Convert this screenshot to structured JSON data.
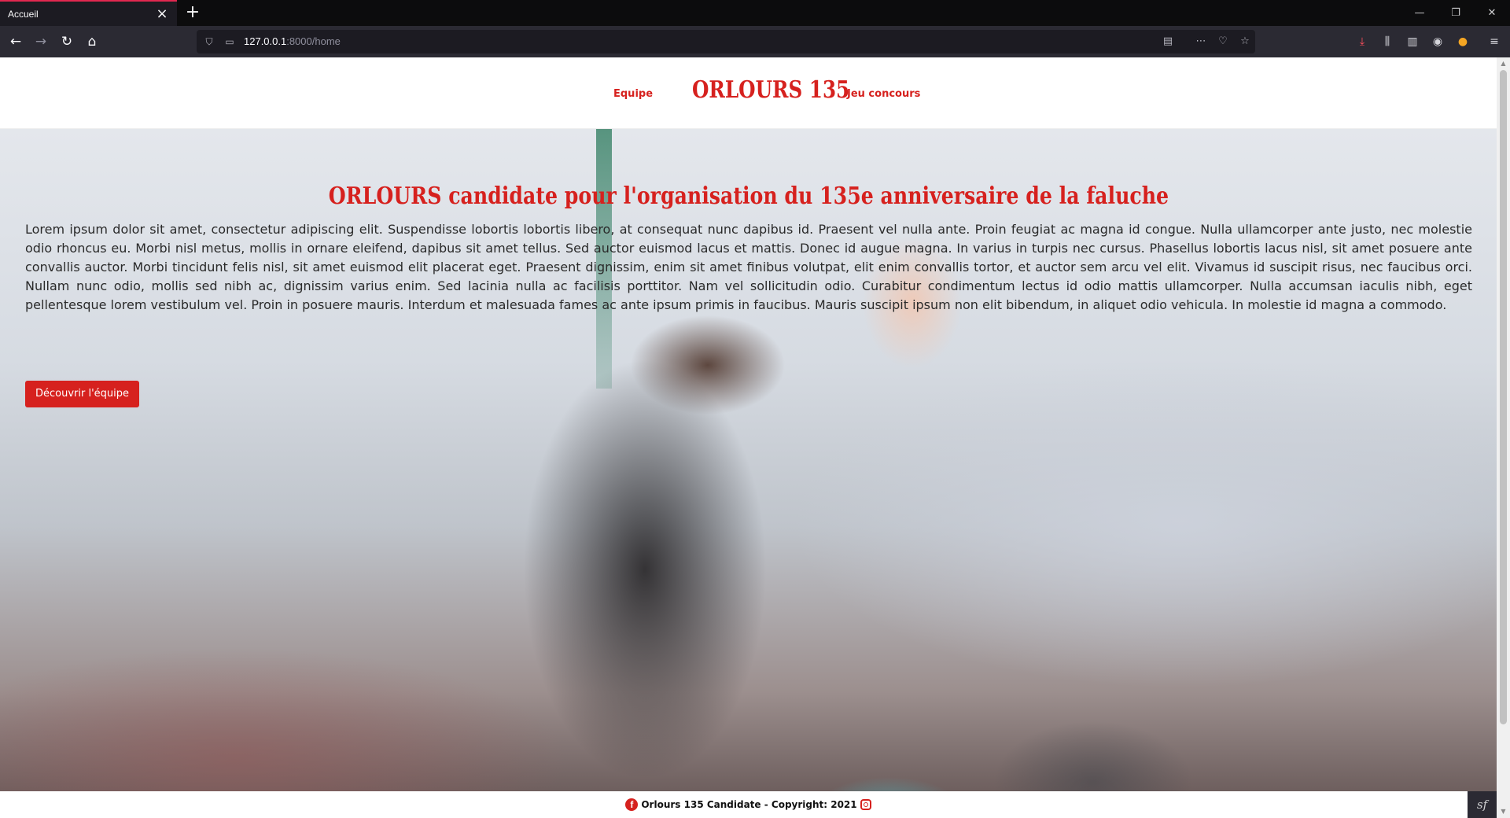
{
  "browser": {
    "tab": {
      "title": "Accueil",
      "close_icon": "×"
    },
    "new_tab_icon": "+",
    "window_controls": {
      "minimize": "—",
      "restore": "❐",
      "close": "✕"
    },
    "nav": {
      "back": "←",
      "forward": "→",
      "reload": "↻",
      "home": "⌂"
    },
    "url": {
      "host": "127.0.0.1",
      "rest": ":8000/home"
    },
    "url_icons": {
      "shield": "⛉",
      "page": "▭",
      "reader": "▤",
      "more": "⋯",
      "pocket": "♡",
      "bookmark": "☆"
    },
    "toolbar_icons": {
      "download": "⤓",
      "library": "⫼",
      "sidebar": "▥",
      "account": "◉",
      "extension": "●",
      "menu": "≡"
    }
  },
  "site": {
    "header": {
      "nav_left": "Equipe",
      "brand": "ORLOURS 135",
      "nav_right": "Jeu concours"
    },
    "hero": {
      "title": "ORLOURS candidate pour l'organisation du 135e anniversaire de la faluche",
      "text": "Lorem ipsum dolor sit amet, consectetur adipiscing elit. Suspendisse lobortis lobortis libero, at consequat nunc dapibus id. Praesent vel nulla ante. Proin feugiat ac magna id congue. Nulla ullamcorper ante justo, nec molestie odio rhoncus eu. Morbi nisl metus, mollis in ornare eleifend, dapibus sit amet tellus. Sed auctor euismod lacus et mattis. Donec id augue magna. In varius in turpis nec cursus. Phasellus lobortis lacus nisl, sit amet posuere ante convallis auctor. Morbi tincidunt felis nisl, sit amet euismod elit placerat eget. Praesent dignissim, enim sit amet finibus volutpat, elit enim convallis tortor, et auctor sem arcu vel elit. Vivamus id suscipit risus, nec faucibus orci. Nullam nunc odio, mollis sed nibh ac, dignissim varius enim. Sed lacinia nulla ac facilisis porttitor. Nam vel sollicitudin odio. Curabitur condimentum lectus id odio mattis ullamcorper. Nulla accumsan iaculis nibh, eget pellentesque lorem vestibulum vel. Proin in posuere mauris. Interdum et malesuada fames ac ante ipsum primis in faucibus. Mauris suscipit ipsum non elit bibendum, in aliquet odio vehicula. In molestie id magna a commodo.",
      "button": "Découvrir l'équipe"
    },
    "footer": {
      "text": "Orlours 135 Candidate - Copyright: 2021",
      "facebook_glyph": "f"
    },
    "symfony_badge": "sf",
    "colors": {
      "accent": "#d6211e",
      "chrome_dark": "#0c0c0d",
      "toolbar": "#2b2a33"
    }
  }
}
